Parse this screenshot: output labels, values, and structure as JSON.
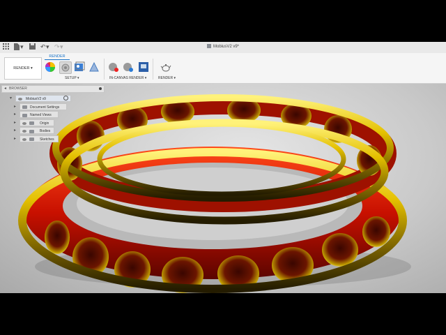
{
  "window": {
    "document_title": "MobiusV2 v9*"
  },
  "toolbar": {
    "icons": [
      "grid-icon",
      "file-icon",
      "save-icon",
      "undo-icon",
      "redo-icon"
    ]
  },
  "ribbon": {
    "active_tab": "RENDER",
    "workspace_switcher": "RENDER ▾",
    "groups": {
      "setup": "SETUP ▾",
      "in_canvas_render": "IN-CANVAS RENDER ▾",
      "render": "RENDER ▾"
    }
  },
  "browser": {
    "title": "BROWSER",
    "root": "MobiusV2 v9",
    "nodes": [
      {
        "label": "Document Settings",
        "icon": "gear-icon"
      },
      {
        "label": "Named Views",
        "icon": "folder-icon"
      },
      {
        "label": "Origin",
        "icon": "folder-icon"
      },
      {
        "label": "Bodies",
        "icon": "folder-icon"
      },
      {
        "label": "Sketches",
        "icon": "folder-icon"
      }
    ]
  },
  "colors": {
    "gold": "#d4b400",
    "red_glass": "#d01800",
    "accent_blue": "#1a73c7"
  }
}
